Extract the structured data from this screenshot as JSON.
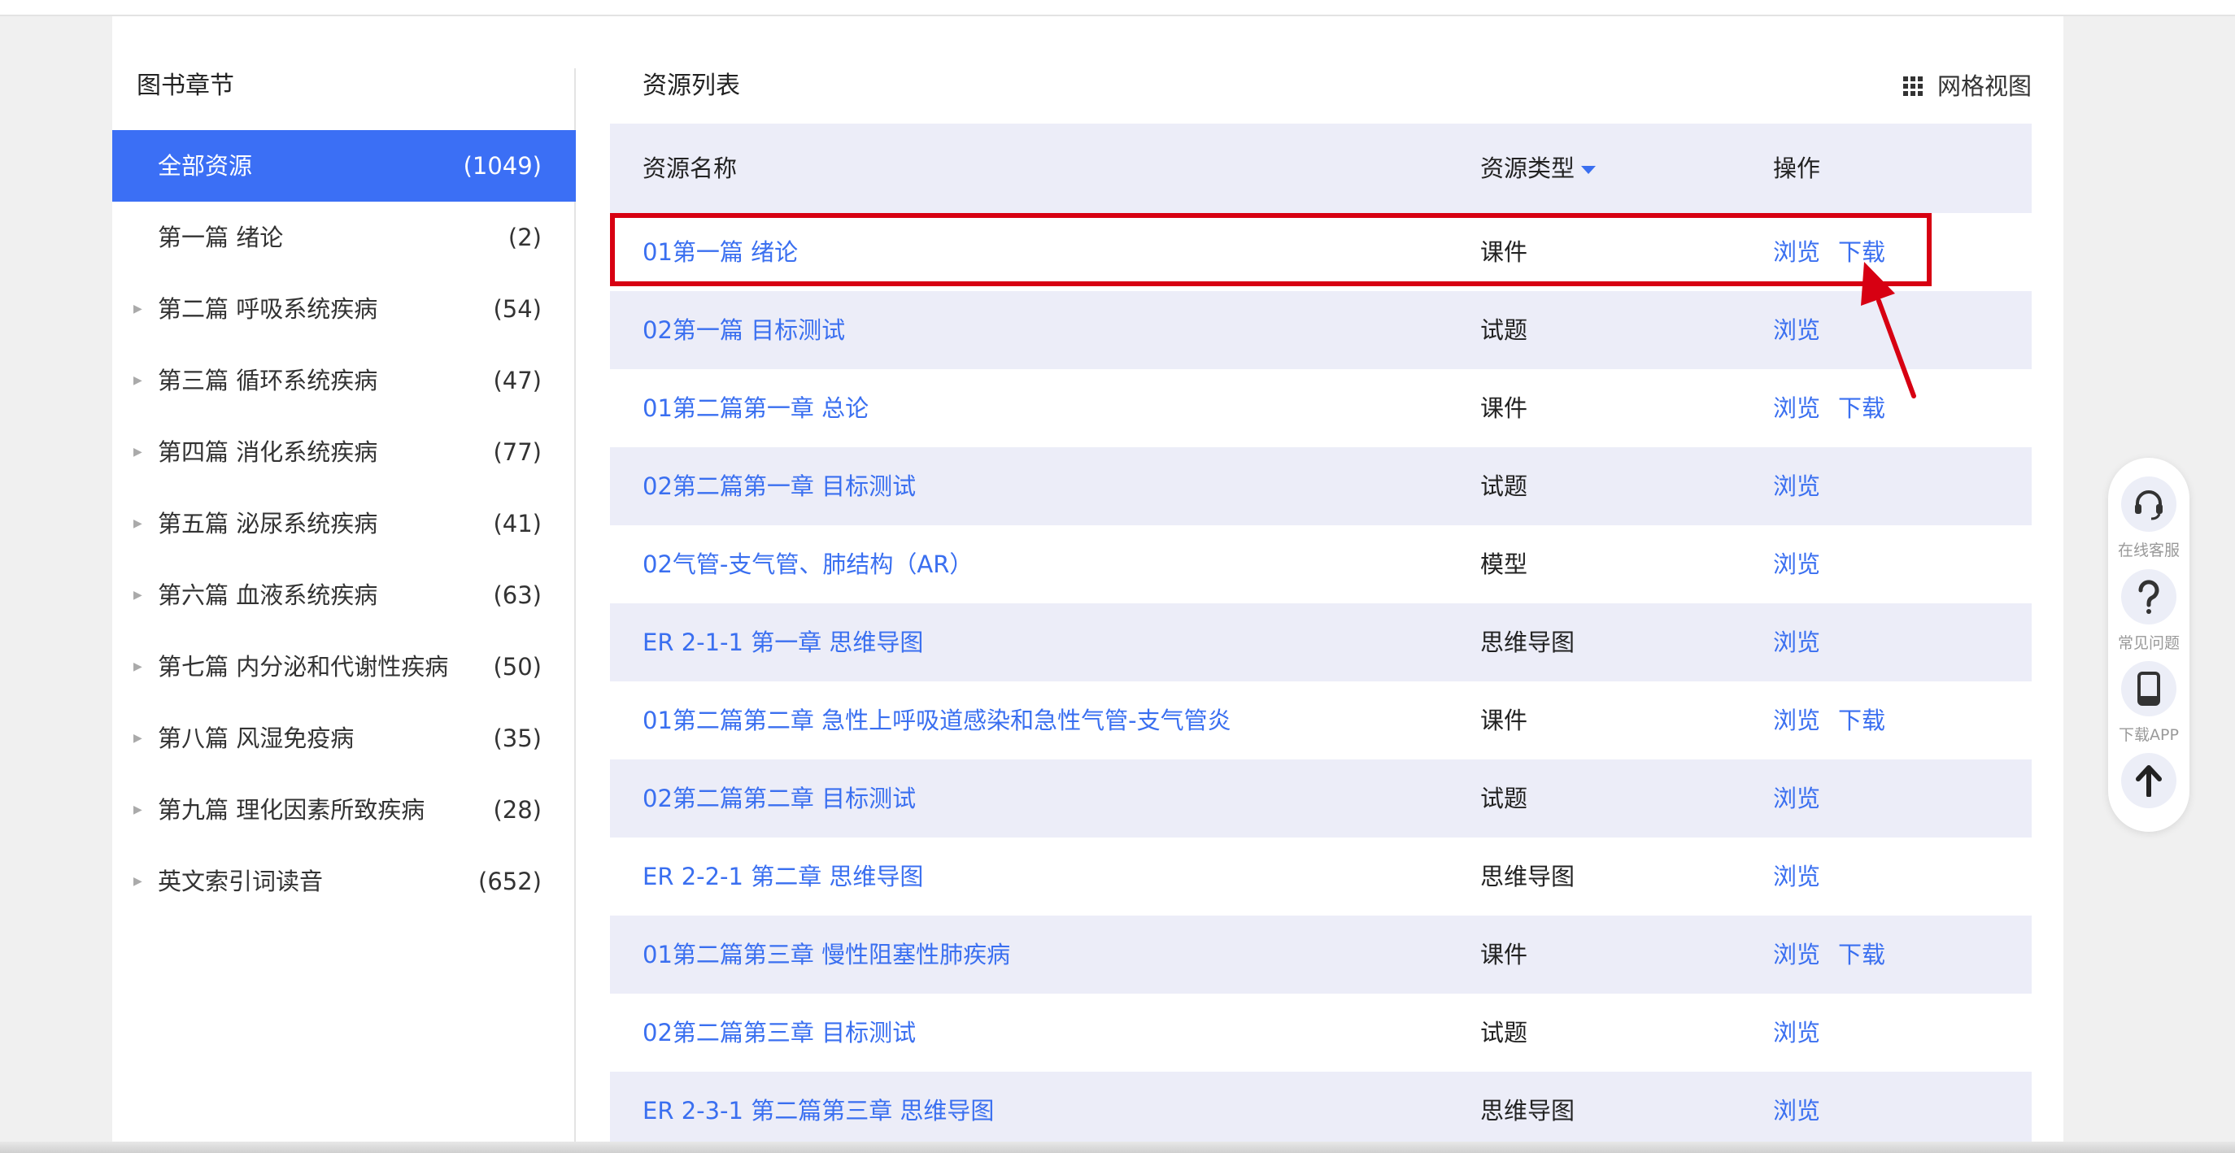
{
  "sidebar": {
    "title": "图书章节",
    "items": [
      {
        "label": "全部资源",
        "count": "(1049)",
        "active": true,
        "expandable": false
      },
      {
        "label": "第一篇 绪论",
        "count": "(2)",
        "active": false,
        "expandable": false
      },
      {
        "label": "第二篇 呼吸系统疾病",
        "count": "(54)",
        "active": false,
        "expandable": true
      },
      {
        "label": "第三篇 循环系统疾病",
        "count": "(47)",
        "active": false,
        "expandable": true
      },
      {
        "label": "第四篇 消化系统疾病",
        "count": "(77)",
        "active": false,
        "expandable": true
      },
      {
        "label": "第五篇 泌尿系统疾病",
        "count": "(41)",
        "active": false,
        "expandable": true
      },
      {
        "label": "第六篇 血液系统疾病",
        "count": "(63)",
        "active": false,
        "expandable": true
      },
      {
        "label": "第七篇 内分泌和代谢性疾病",
        "count": "(50)",
        "active": false,
        "expandable": true
      },
      {
        "label": "第八篇 风湿免疫病",
        "count": "(35)",
        "active": false,
        "expandable": true
      },
      {
        "label": "第九篇 理化因素所致疾病",
        "count": "(28)",
        "active": false,
        "expandable": true
      },
      {
        "label": "英文索引词读音",
        "count": "(652)",
        "active": false,
        "expandable": true
      }
    ]
  },
  "main": {
    "title": "资源列表",
    "grid_view_label": "网格视图",
    "columns": {
      "name": "资源名称",
      "type": "资源类型",
      "ops": "操作"
    },
    "rows": [
      {
        "name": "01第一篇 绪论",
        "type": "课件",
        "ops": [
          "浏览",
          "下载"
        ]
      },
      {
        "name": "02第一篇 目标测试",
        "type": "试题",
        "ops": [
          "浏览"
        ]
      },
      {
        "name": "01第二篇第一章 总论",
        "type": "课件",
        "ops": [
          "浏览",
          "下载"
        ]
      },
      {
        "name": "02第二篇第一章 目标测试",
        "type": "试题",
        "ops": [
          "浏览"
        ]
      },
      {
        "name": "02气管-支气管、肺结构（AR）",
        "type": "模型",
        "ops": [
          "浏览"
        ]
      },
      {
        "name": "ER 2-1-1 第一章 思维导图",
        "type": "思维导图",
        "ops": [
          "浏览"
        ]
      },
      {
        "name": "01第二篇第二章 急性上呼吸道感染和急性气管-支气管炎",
        "type": "课件",
        "ops": [
          "浏览",
          "下载"
        ]
      },
      {
        "name": "02第二篇第二章 目标测试",
        "type": "试题",
        "ops": [
          "浏览"
        ]
      },
      {
        "name": "ER 2-2-1 第二章 思维导图",
        "type": "思维导图",
        "ops": [
          "浏览"
        ]
      },
      {
        "name": "01第二篇第三章 慢性阻塞性肺疾病",
        "type": "课件",
        "ops": [
          "浏览",
          "下载"
        ]
      },
      {
        "name": "02第二篇第三章 目标测试",
        "type": "试题",
        "ops": [
          "浏览"
        ]
      },
      {
        "name": "ER 2-3-1 第二篇第三章 思维导图",
        "type": "思维导图",
        "ops": [
          "浏览"
        ]
      }
    ]
  },
  "float_bar": {
    "items": [
      {
        "label": "在线客服",
        "icon": "headset-icon"
      },
      {
        "label": "常见问题",
        "icon": "question-icon"
      },
      {
        "label": "下载APP",
        "icon": "phone-icon"
      },
      {
        "label": "",
        "icon": "arrow-up-icon"
      }
    ]
  },
  "colors": {
    "accent": "#3b6ff5",
    "link": "#3a6ff0",
    "annotation": "#d70012",
    "row_alt": "#ecedf8"
  }
}
